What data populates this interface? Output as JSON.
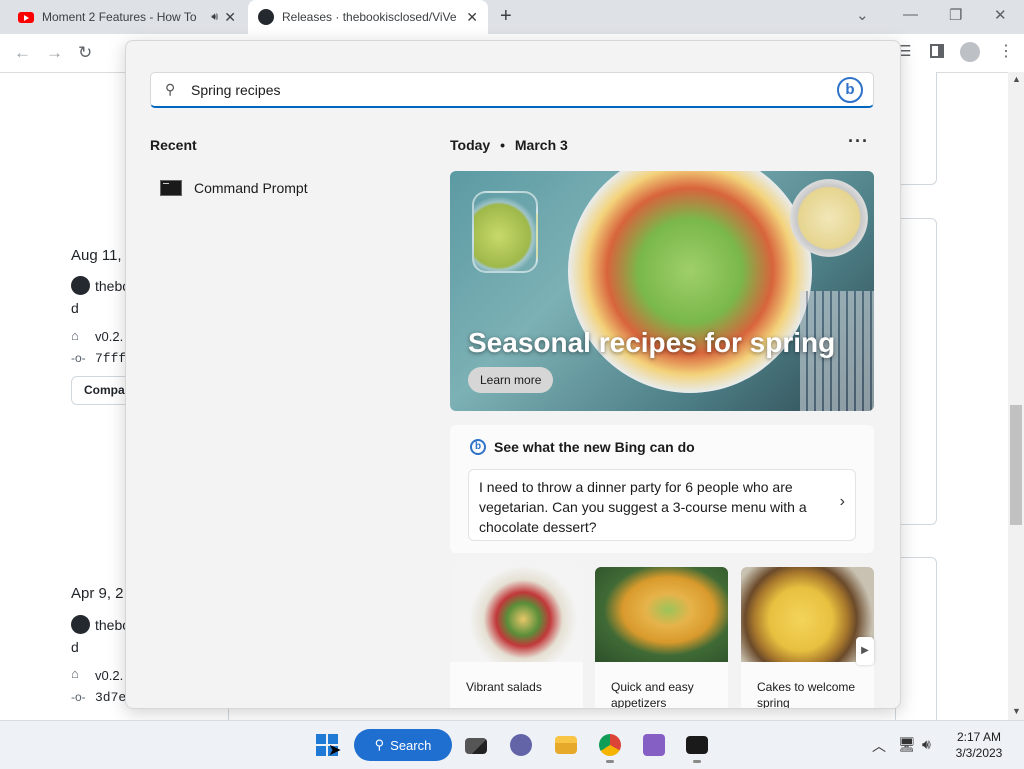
{
  "browser": {
    "tabs": [
      {
        "title": "Moment 2 Features - How To",
        "active": false
      },
      {
        "title": "Releases · thebookisclosed/ViVe",
        "active": true
      }
    ],
    "new_tab_label": "+"
  },
  "background_page": {
    "release1": {
      "date": "Aug 11,",
      "user": "thebo",
      "user_wrap": "d",
      "tag": "v0.2.",
      "commit": "7fff",
      "compare": "Compa"
    },
    "release2": {
      "date": "Apr 9, 2",
      "user": "thebo",
      "user_wrap": "d",
      "tag": "v0.2.",
      "commit": "3d7e"
    }
  },
  "search": {
    "query": "Spring recipes",
    "recent_heading": "Recent",
    "recent_items": [
      {
        "label": "Command Prompt"
      }
    ],
    "date_today": "Today",
    "date_sep": "•",
    "date_value": "March 3",
    "more_label": "···",
    "hero": {
      "title": "Seasonal recipes for spring",
      "button": "Learn more"
    },
    "bing_card": {
      "heading": "See what the new Bing can do",
      "prompt": "I need to throw a dinner party for 6 people who are vegetarian. Can you suggest a 3-course menu with a chocolate dessert?"
    },
    "tiles": [
      {
        "caption": "Vibrant salads"
      },
      {
        "caption": "Quick and easy appetizers"
      },
      {
        "caption": "Cakes to welcome spring"
      }
    ]
  },
  "taskbar": {
    "search_label": "Search",
    "time": "2:17 AM",
    "date": "3/3/2023"
  }
}
